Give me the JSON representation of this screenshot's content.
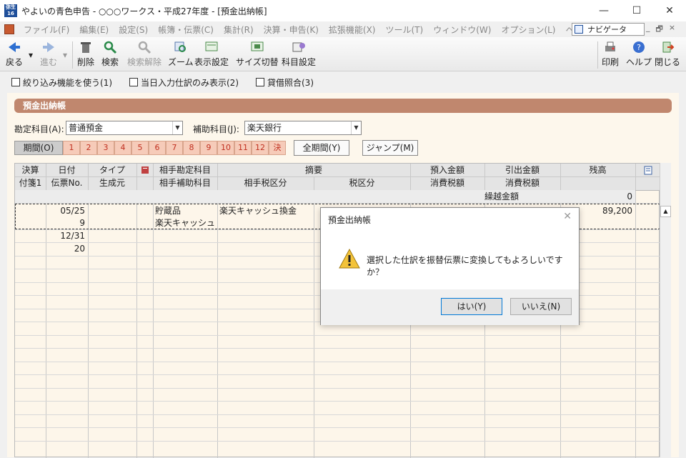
{
  "window": {
    "logo_text": "弥生16",
    "title": "やよいの青色申告 - ○○○ワークス・平成27年度 - [預金出納帳]",
    "minimize": "—",
    "maximize": "☐",
    "close": "✕"
  },
  "menu": {
    "items": [
      "ファイル(F)",
      "編集(E)",
      "設定(S)",
      "帳簿・伝票(C)",
      "集計(R)",
      "決算・申告(K)",
      "拡張機能(X)",
      "ツール(T)",
      "ウィンドウ(W)",
      "オプション(L)",
      "ヘルプ(H)"
    ],
    "navigator": "ナビゲータ",
    "mdi_min": "_",
    "mdi_restore": "🗗",
    "mdi_close": "×"
  },
  "toolbar": {
    "back": "戻る",
    "forward": "進む",
    "delete": "削除",
    "search": "検索",
    "search_clear": "検索解除",
    "zoom": "ズーム",
    "display_settings": "表示設定",
    "size_toggle": "サイズ切替",
    "account_settings": "科目設定",
    "print": "印刷",
    "help": "ヘルプ",
    "close": "閉じる"
  },
  "options": {
    "filter": "絞り込み機能を使う(1)",
    "today_only": "当日入力仕訳のみ表示(2)",
    "balance_check": "貸借照合(3)"
  },
  "ledger": {
    "title": "預金出納帳",
    "account_label": "勘定科目(A):",
    "account_value": "普通預金",
    "sub_account_label": "補助科目(J):",
    "sub_account_value": "楽天銀行",
    "period_label": "期間(O)",
    "months": [
      "1",
      "2",
      "3",
      "4",
      "5",
      "6",
      "7",
      "8",
      "9",
      "10",
      "11",
      "12",
      "決"
    ],
    "full_period": "全期間(Y)",
    "jump": "ジャンプ(M)"
  },
  "grid": {
    "headers_top": [
      "決算",
      "日付",
      "タイプ",
      "相手勘定科目",
      "摘要",
      "預入金額",
      "引出金額",
      "残高"
    ],
    "headers_bottom": [
      "付箋1",
      "伝票No.",
      "生成元",
      "相手補助科目",
      "相手税区分",
      "税区分",
      "消費税額",
      "消費税額"
    ],
    "carry_label": "繰越金額",
    "carry_value": "0",
    "row1": {
      "date": "05/25",
      "voucher": "9",
      "account": "貯蔵品",
      "sub_account": "楽天キャッシュ",
      "description": "楽天キャッシュ換金",
      "balance": "89,200"
    },
    "row2": {
      "date": "12/31",
      "voucher": "20"
    }
  },
  "dialog": {
    "title": "預金出納帳",
    "message": "選択した仕訳を振替伝票に変換してもよろしいですか？",
    "yes": "はい(Y)",
    "no": "いいえ(N)",
    "close": "✕"
  }
}
